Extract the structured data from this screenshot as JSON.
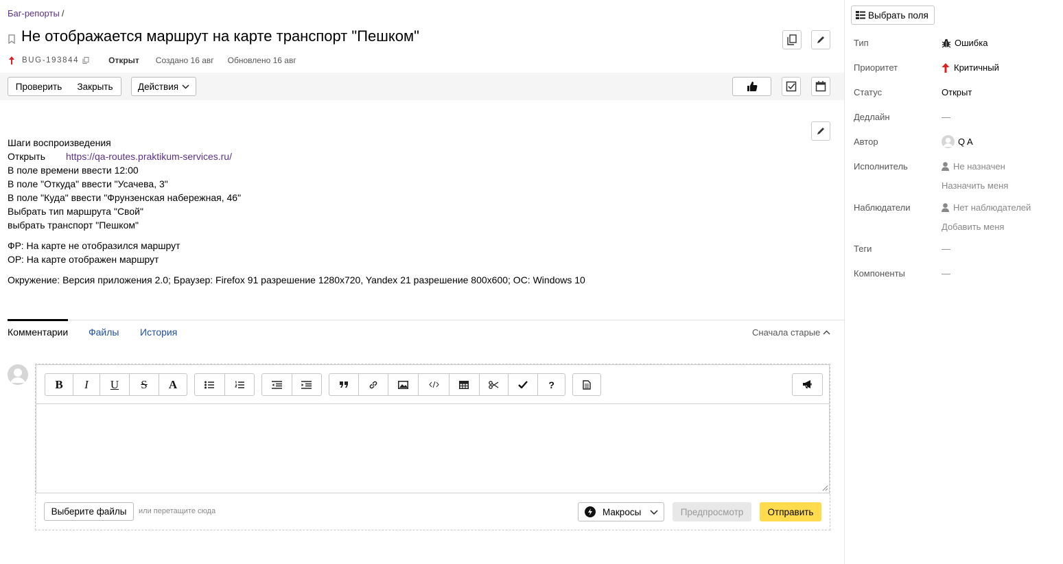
{
  "breadcrumb": {
    "label": "Баг-репорты",
    "sep": "/"
  },
  "issue": {
    "title": "Не отображается маршрут на карте транспорт \"Пешком\"",
    "key": "BUG-193844",
    "status": "Открыт",
    "created": "Создано 16 авг",
    "updated": "Обновлено 16 авг"
  },
  "toolbar": {
    "check_label": "Проверить",
    "close_label": "Закрыть",
    "actions_label": "Действия"
  },
  "description": {
    "heading": "Шаги воспроизведения",
    "open_label": "Открыть",
    "open_link": "https://qa-routes.praktikum-services.ru/",
    "steps": [
      "В поле времени ввести 12:00",
      "В поле \"Откуда\" ввести \"Усачева, 3\"",
      "В поле \"Куда\" ввести \"Фрунзенская набережная, 46\"",
      "Выбрать тип маршрута \"Свой\"",
      "выбрать транспорт \"Пешком\""
    ],
    "fr": "ФР: На карте не отобразился маршрут",
    "or": "ОР: На карте отображен маршрут",
    "env": "Окружение: Версия приложения 2.0; Браузер: Firefox 91 разрешение 1280x720, Yandex 21 разрешение 800x600; ОС: Windows 10"
  },
  "tabs": {
    "comments": "Комментарии",
    "files": "Файлы",
    "history": "История",
    "sort": "Сначала старые"
  },
  "editor": {
    "toolbar": {
      "bold": "B",
      "italic": "I",
      "underline": "U",
      "strike": "S",
      "font": "A",
      "help": "?"
    },
    "choose_files": "Выберите файлы",
    "drop_hint": "или перетащите сюда",
    "macros": "Макросы",
    "preview": "Предпросмотр",
    "send": "Отправить"
  },
  "sidebar": {
    "select_fields": "Выбрать поля",
    "fields": {
      "type": {
        "label": "Тип",
        "value": "Ошибка"
      },
      "priority": {
        "label": "Приоритет",
        "value": "Критичный"
      },
      "status": {
        "label": "Статус",
        "value": "Открыт"
      },
      "deadline": {
        "label": "Дедлайн",
        "value": "—"
      },
      "author": {
        "label": "Автор",
        "value": "Q A"
      },
      "assignee": {
        "label": "Исполнитель",
        "value": "Не назначен",
        "action": "Назначить меня"
      },
      "followers": {
        "label": "Наблюдатели",
        "value": "Нет наблюдателей",
        "action": "Добавить меня"
      },
      "tags": {
        "label": "Теги",
        "value": "—"
      },
      "components": {
        "label": "Компоненты",
        "value": "—"
      }
    }
  },
  "colors": {
    "priority_red": "#e02020",
    "send_yellow": "#ffdb4d",
    "link_purple": "#5b2f8c",
    "tab_blue": "#1f4fa8"
  }
}
